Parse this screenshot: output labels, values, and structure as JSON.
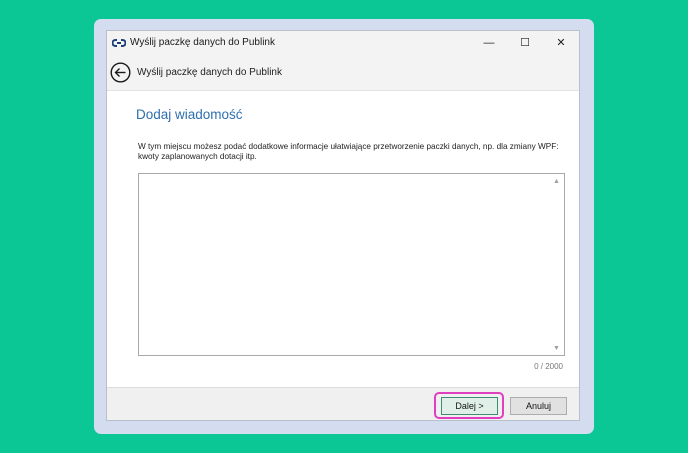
{
  "window": {
    "title": "Wyślij paczkę danych do Publink",
    "minimize_glyph": "—",
    "maximize_glyph": "☐",
    "close_glyph": "✕"
  },
  "nav": {
    "title": "Wyślij paczkę danych do Publink"
  },
  "content": {
    "section_title": "Dodaj wiadomość",
    "description": "W tym miejscu możesz podać dodatkowe informacje ułatwiające przetworzenie paczki danych, np. dla zmiany WPF: kwoty zaplanowanych dotacji itp.",
    "message_value": "",
    "char_counter": "0 / 2000"
  },
  "footer": {
    "next_label": "Dalej >",
    "cancel_label": "Anuluj"
  },
  "colors": {
    "background": "#0bc796",
    "accent": "#2e6faf",
    "highlight": "#e040c0"
  }
}
